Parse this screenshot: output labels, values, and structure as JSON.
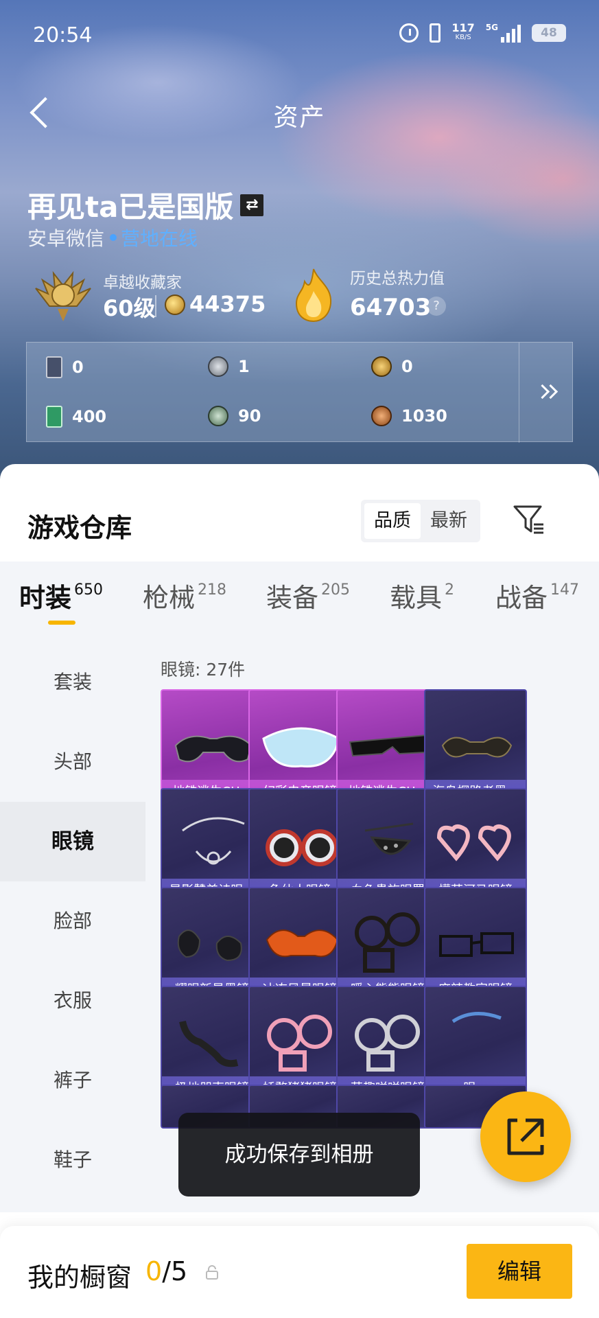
{
  "status_bar": {
    "time": "20:54",
    "net_speed": "117",
    "net_unit": "KB/S",
    "network": "5G",
    "battery": "48"
  },
  "nav": {
    "title": "资产"
  },
  "user": {
    "name": "再见ta已是国版",
    "platform": "安卓微信",
    "status": "营地在线"
  },
  "stats": {
    "rank_title": "卓越收藏家",
    "level": "60级",
    "coins": "44375",
    "heat_label": "历史总热力值",
    "heat_value": "64703",
    "help": "?"
  },
  "currencies": [
    {
      "icon": "card-dark-icon",
      "value": "0",
      "color": "#46506a"
    },
    {
      "icon": "silver-coin-icon",
      "value": "1",
      "color": "#9aa0a8"
    },
    {
      "icon": "gold-badge-icon",
      "value": "0",
      "color": "#c99a2c"
    },
    {
      "icon": "card-green-icon",
      "value": "400",
      "color": "#2f9a64"
    },
    {
      "icon": "green-coin-icon",
      "value": "90",
      "color": "#6f9a7a"
    },
    {
      "icon": "bronze-coin-icon",
      "value": "1030",
      "color": "#b5672d"
    }
  ],
  "warehouse": {
    "title": "游戏仓库",
    "sort_options": [
      "品质",
      "最新"
    ],
    "sort_selected": "品质",
    "tabs": [
      {
        "label": "时装",
        "count": "650"
      },
      {
        "label": "枪械",
        "count": "218"
      },
      {
        "label": "装备",
        "count": "205"
      },
      {
        "label": "载具",
        "count": "2"
      },
      {
        "label": "战备",
        "count": "147"
      }
    ],
    "active_tab": "时装",
    "categories": [
      "套装",
      "头部",
      "眼镜",
      "脸部",
      "衣服",
      "裤子",
      "鞋子"
    ],
    "active_category": "眼镜",
    "section_header": "眼镜: 27件",
    "items": [
      {
        "name": "地铁逃生CH...",
        "rarity": "epic"
      },
      {
        "name": "幻彩电音眼镜",
        "rarity": "epic"
      },
      {
        "name": "地铁逃生CH...",
        "rarity": "epic"
      },
      {
        "name": "海岛探路者墨...",
        "rarity": "rare"
      },
      {
        "name": "星影赞美诗眼...",
        "rarity": "rare"
      },
      {
        "name": "龟仙人眼镜",
        "rarity": "rare"
      },
      {
        "name": "血色贵族眼罩",
        "rarity": "rare"
      },
      {
        "name": "懵萌河马眼镜",
        "rarity": "rare"
      },
      {
        "name": "耀眼新星墨镜",
        "rarity": "rare"
      },
      {
        "name": "冰冻风暴眼镜",
        "rarity": "rare"
      },
      {
        "name": "暖心熊熊眼镜",
        "rarity": "rare"
      },
      {
        "name": "麻辣教官眼镜",
        "rarity": "rare"
      },
      {
        "name": "极地朋克眼镜",
        "rarity": "rare"
      },
      {
        "name": "娇憨猪猪眼镜",
        "rarity": "rare"
      },
      {
        "name": "萌趣咩咩眼镜",
        "rarity": "rare"
      },
      {
        "name": "眼...",
        "rarity": "rare"
      }
    ]
  },
  "toast": "成功保存到相册",
  "showcase": {
    "label": "我的橱窗",
    "current": "0",
    "total": "/5"
  },
  "edit_label": "编辑",
  "colors": {
    "accent": "#fbb614",
    "epic": "#b54bc6",
    "rare": "#3a3566"
  }
}
